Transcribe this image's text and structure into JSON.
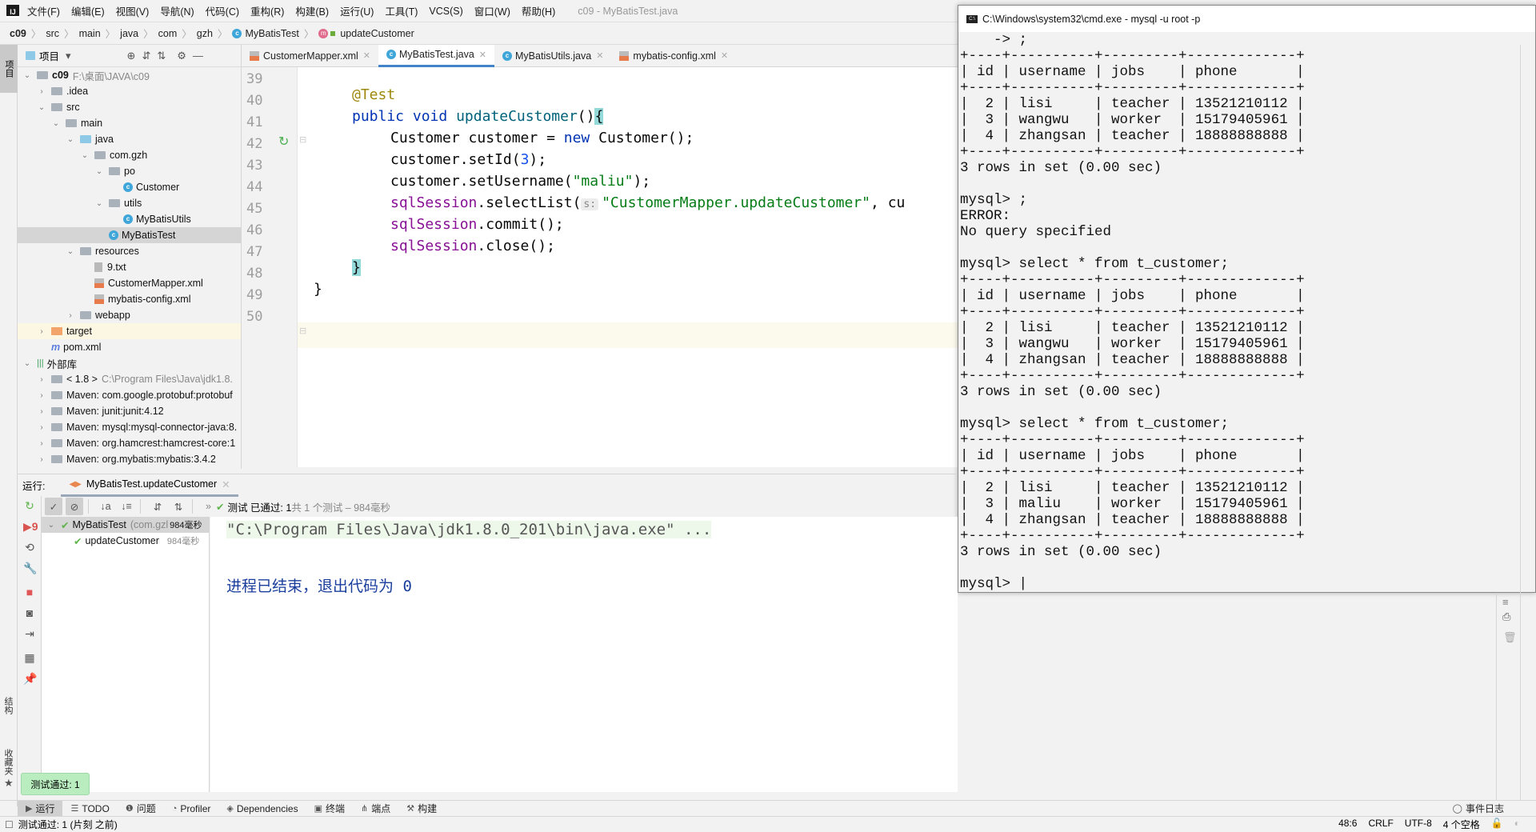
{
  "menubar": {
    "items": [
      "文件(F)",
      "编辑(E)",
      "视图(V)",
      "导航(N)",
      "代码(C)",
      "重构(R)",
      "构建(B)",
      "运行(U)",
      "工具(T)",
      "VCS(S)",
      "窗口(W)",
      "帮助(H)"
    ],
    "window_title": "c09 - MyBatisTest.java"
  },
  "breadcrumb": [
    "c09",
    "src",
    "main",
    "java",
    "com",
    "gzh",
    "MyBatisTest",
    "updateCustomer"
  ],
  "left_stripe": {
    "project_tab": "项目",
    "structure_tab": "结构",
    "favorites_tab": "收藏夹"
  },
  "project": {
    "header": "项目",
    "tree": [
      {
        "label": "c09",
        "extra": "F:\\桌面\\JAVA\\c09",
        "depth": 0,
        "arrow": "down",
        "icon": "folder"
      },
      {
        "label": ".idea",
        "depth": 1,
        "arrow": "right",
        "icon": "folder"
      },
      {
        "label": "src",
        "depth": 1,
        "arrow": "down",
        "icon": "folder"
      },
      {
        "label": "main",
        "depth": 2,
        "arrow": "down",
        "icon": "folder"
      },
      {
        "label": "java",
        "depth": 3,
        "arrow": "down",
        "icon": "src"
      },
      {
        "label": "com.gzh",
        "depth": 4,
        "arrow": "down",
        "icon": "pkg"
      },
      {
        "label": "po",
        "depth": 5,
        "arrow": "down",
        "icon": "pkg"
      },
      {
        "label": "Customer",
        "depth": 6,
        "arrow": "",
        "icon": "class"
      },
      {
        "label": "utils",
        "depth": 5,
        "arrow": "down",
        "icon": "pkg"
      },
      {
        "label": "MyBatisUtils",
        "depth": 6,
        "arrow": "",
        "icon": "class"
      },
      {
        "label": "MyBatisTest",
        "depth": 5,
        "arrow": "",
        "icon": "class",
        "selected": true
      },
      {
        "label": "resources",
        "depth": 3,
        "arrow": "down",
        "icon": "folder"
      },
      {
        "label": "9.txt",
        "depth": 4,
        "arrow": "",
        "icon": "file"
      },
      {
        "label": "CustomerMapper.xml",
        "depth": 4,
        "arrow": "",
        "icon": "xml"
      },
      {
        "label": "mybatis-config.xml",
        "depth": 4,
        "arrow": "",
        "icon": "xml"
      },
      {
        "label": "webapp",
        "depth": 3,
        "arrow": "right",
        "icon": "pkg"
      },
      {
        "label": "target",
        "depth": 1,
        "arrow": "right",
        "icon": "tgt",
        "highlight": true
      },
      {
        "label": "pom.xml",
        "depth": 1,
        "arrow": "",
        "icon": "mvn"
      },
      {
        "label": "外部库",
        "depth": 0,
        "arrow": "down",
        "icon": "libs"
      },
      {
        "label": "< 1.8 >",
        "extra": "C:\\Program Files\\Java\\jdk1.8.",
        "depth": 1,
        "arrow": "right",
        "icon": "lib"
      },
      {
        "label": "Maven: com.google.protobuf:protobuf",
        "depth": 1,
        "arrow": "right",
        "icon": "lib"
      },
      {
        "label": "Maven: junit:junit:4.12",
        "depth": 1,
        "arrow": "right",
        "icon": "lib"
      },
      {
        "label": "Maven: mysql:mysql-connector-java:8.",
        "depth": 1,
        "arrow": "right",
        "icon": "lib"
      },
      {
        "label": "Maven: org.hamcrest:hamcrest-core:1",
        "depth": 1,
        "arrow": "right",
        "icon": "lib"
      },
      {
        "label": "Maven: org.mybatis:mybatis:3.4.2",
        "depth": 1,
        "arrow": "right",
        "icon": "lib"
      }
    ]
  },
  "editor": {
    "tabs": [
      {
        "label": "CustomerMapper.xml",
        "icon": "xml"
      },
      {
        "label": "MyBatisTest.java",
        "icon": "class",
        "active": true
      },
      {
        "label": "MyBatisUtils.java",
        "icon": "class"
      },
      {
        "label": "mybatis-config.xml",
        "icon": "xml"
      }
    ],
    "line_numbers": [
      "39",
      "40",
      "41",
      "42",
      "43",
      "44",
      "45",
      "46",
      "47",
      "48",
      "49",
      "50"
    ],
    "code": {
      "l40_annotation": "@Test",
      "l41_public": "public",
      "l41_void": "void",
      "l41_name": "updateCustomer",
      "l41_rest": "()",
      "l41_brace": "{",
      "l42_a": "Customer customer = ",
      "l42_new": "new",
      "l42_b": " Customer();",
      "l43_a": "customer.setId(",
      "l43_num": "3",
      "l43_b": ");",
      "l44_a": "customer.setUsername(",
      "l44_str": "\"maliu\"",
      "l44_b": ");",
      "l45_fld": "sqlSession",
      "l45_a": ".selectList(",
      "l45_hint": "s:",
      "l45_str": "\"CustomerMapper.updateCustomer\"",
      "l45_b": ", cu",
      "l46_fld": "sqlSession",
      "l46_a": ".commit();",
      "l47_fld": "sqlSession",
      "l47_a": ".close();",
      "l48_brace": "}",
      "l49_brace": "}"
    }
  },
  "cmd": {
    "title": "C:\\Windows\\system32\\cmd.exe - mysql  -u root -p",
    "lines": [
      "    -> ;",
      "+----+----------+---------+-------------+",
      "| id | username | jobs    | phone       |",
      "+----+----------+---------+-------------+",
      "|  2 | lisi     | teacher | 13521210112 |",
      "|  3 | wangwu   | worker  | 15179405961 |",
      "|  4 | zhangsan | teacher | 18888888888 |",
      "+----+----------+---------+-------------+",
      "3 rows in set (0.00 sec)",
      "",
      "mysql> ;",
      "ERROR:",
      "No query specified",
      "",
      "mysql> select * from t_customer;",
      "+----+----------+---------+-------------+",
      "| id | username | jobs    | phone       |",
      "+----+----------+---------+-------------+",
      "|  2 | lisi     | teacher | 13521210112 |",
      "|  3 | wangwu   | worker  | 15179405961 |",
      "|  4 | zhangsan | teacher | 18888888888 |",
      "+----+----------+---------+-------------+",
      "3 rows in set (0.00 sec)",
      "",
      "mysql> select * from t_customer;",
      "+----+----------+---------+-------------+",
      "| id | username | jobs    | phone       |",
      "+----+----------+---------+-------------+",
      "|  2 | lisi     | teacher | 13521210112 |",
      "|  3 | maliu    | worker  | 15179405961 |",
      "|  4 | zhangsan | teacher | 18888888888 |",
      "+----+----------+---------+-------------+",
      "3 rows in set (0.00 sec)",
      "",
      "mysql> |"
    ]
  },
  "run": {
    "label": "运行:",
    "tab": "MyBatisTest.updateCustomer",
    "status_passed": "测试 已通过: 1",
    "status_total": "共 1 个测试 – 984毫秒",
    "tree": [
      {
        "label": "MyBatisTest",
        "extra": "(com.gzl",
        "time": "984毫秒"
      },
      {
        "label": "updateCustomer",
        "time": "984毫秒"
      }
    ],
    "console_cmd": "\"C:\\Program Files\\Java\\jdk1.8.0_201\\bin\\java.exe\" ...",
    "console_exit": "进程已结束，退出代码为 0",
    "toast": "测试通过: 1"
  },
  "toolwindows": [
    "运行",
    "TODO",
    "问题",
    "Profiler",
    "Dependencies",
    "终端",
    "端点",
    "构建"
  ],
  "event_log": "事件日志",
  "status": {
    "message": "测试通过: 1 (片刻 之前)",
    "position": "48:6",
    "line_sep": "CRLF",
    "encoding": "UTF-8",
    "indent": "4 个空格"
  }
}
